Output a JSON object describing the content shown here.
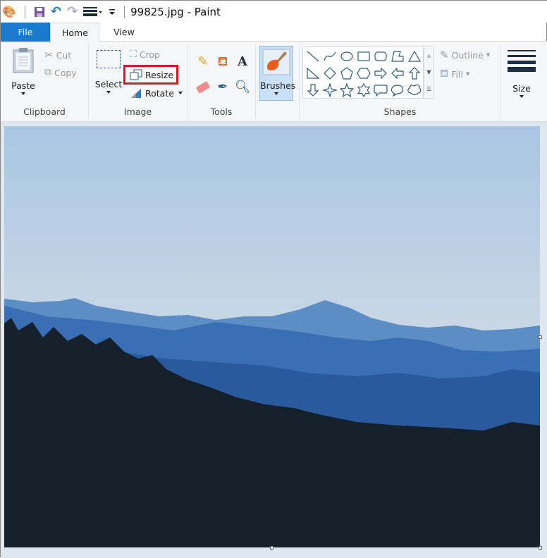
{
  "window": {
    "title": "99825.jpg - Paint"
  },
  "quick_access": [
    "paint-app-icon",
    "save-icon",
    "undo-icon",
    "redo-icon",
    "line-size-icon",
    "customize-dropdown-icon"
  ],
  "tabs": [
    {
      "label": "File"
    },
    {
      "label": "Home",
      "active": true
    },
    {
      "label": "View"
    }
  ],
  "clipboard": {
    "label": "Clipboard",
    "paste": "Paste",
    "cut": "Cut",
    "copy": "Copy"
  },
  "image": {
    "label": "Image",
    "select": "Select",
    "crop": "Crop",
    "resize": "Resize",
    "rotate": "Rotate",
    "highlighted": "Resize",
    "highlight_color": "#e81123"
  },
  "tools": {
    "label": "Tools",
    "items": [
      "pencil-icon",
      "fill-bucket-icon",
      "text-icon",
      "eraser-icon",
      "color-picker-icon",
      "magnifier-icon"
    ]
  },
  "brushes": {
    "label": "Brushes"
  },
  "shapes": {
    "label": "Shapes",
    "outline": "Outline",
    "fill": "Fill",
    "items": [
      "line",
      "curve",
      "oval",
      "rectangle",
      "rounded-rectangle",
      "polygon",
      "triangle",
      "right-triangle",
      "diamond",
      "pentagon",
      "hexagon",
      "right-arrow",
      "left-arrow",
      "up-arrow",
      "down-arrow",
      "four-point-star",
      "five-point-star",
      "six-point-star",
      "rounded-callout",
      "oval-callout",
      "cloud-callout"
    ]
  },
  "size": {
    "label": "Size"
  },
  "colors": {
    "accent": "#1979ca",
    "sky_top": "#a9c6e3",
    "sky_bottom": "#cdd8e2",
    "forest": "#15202b"
  }
}
